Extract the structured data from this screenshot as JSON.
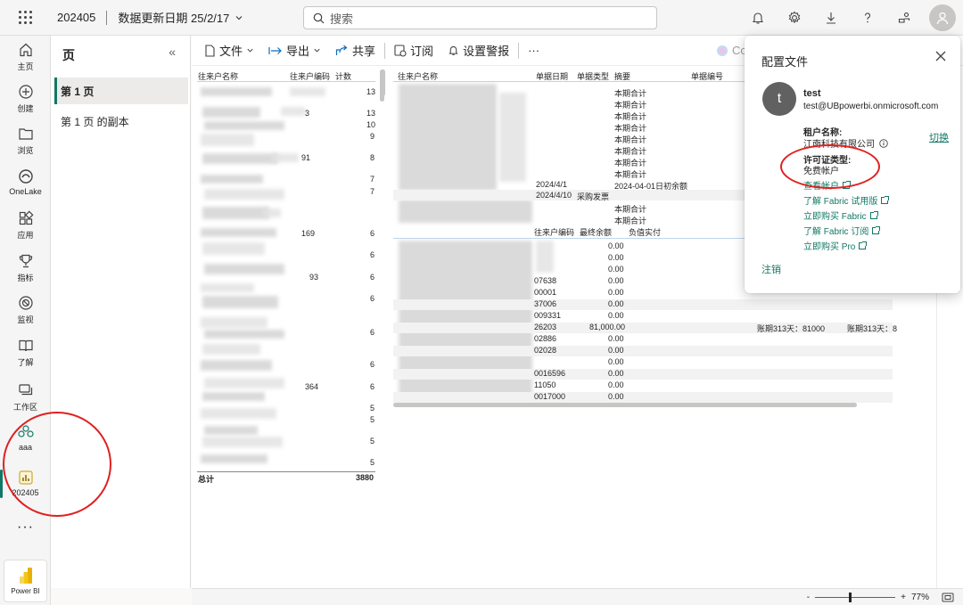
{
  "topbar": {
    "workspace": "202405",
    "refresh_label": "数据更新日期 25/2/17",
    "search_placeholder": "搜索"
  },
  "rail": [
    {
      "label": "主页",
      "icon": "home-icon"
    },
    {
      "label": "创建",
      "icon": "create-icon"
    },
    {
      "label": "浏览",
      "icon": "browse-icon"
    },
    {
      "label": "OneLake",
      "icon": "onelake-icon"
    },
    {
      "label": "应用",
      "icon": "apps-icon"
    },
    {
      "label": "指标",
      "icon": "metrics-icon"
    },
    {
      "label": "监视",
      "icon": "monitor-icon"
    },
    {
      "label": "了解",
      "icon": "learn-icon"
    },
    {
      "label": "工作区",
      "icon": "workspaces-icon"
    },
    {
      "label": "aaa",
      "icon": "workspace-aaa-icon"
    },
    {
      "label": "202405",
      "icon": "report-icon"
    }
  ],
  "rail_more": "···",
  "powerbi_label": "Power BI",
  "pages_pane": {
    "title": "页",
    "collapse": "«",
    "items": [
      "第 1 页",
      "第 1 页 的副本"
    ]
  },
  "toolbar": {
    "file": "文件",
    "export": "导出",
    "share": "共享",
    "subscribe": "订阅",
    "alert": "设置警报",
    "more": "···",
    "copilot": "Co"
  },
  "table1": {
    "headers": [
      "往来户名称",
      "往来户编码",
      "计数"
    ],
    "counts": [
      "13",
      "13",
      "10",
      "9",
      "8",
      "7",
      "7",
      "6",
      "6",
      "6",
      "6",
      "6",
      "6",
      "6",
      "5",
      "5",
      "5",
      "5",
      "5"
    ],
    "partial_codes": [
      "3",
      "91",
      "169",
      "93",
      "364"
    ],
    "total_label": "总计",
    "total_value": "3880"
  },
  "table2": {
    "headers": [
      "往来户名称",
      "单据日期",
      "单据类型",
      "摘要",
      "单据编号"
    ],
    "summaries": [
      "本期合计",
      "本期合计",
      "本期合计",
      "本期合计",
      "本期合计",
      "本期合计",
      "本期合计",
      "本期合计"
    ],
    "row_a": {
      "date": "2024/4/1",
      "summary": "2024-04-01日初余额"
    },
    "row_b": {
      "date": "2024/4/10",
      "type": "采购发票"
    },
    "summaries_after": [
      "本期合计",
      "本期合计"
    ]
  },
  "table3": {
    "headers": [
      "往来户编码",
      "最终余额",
      "负值实付"
    ],
    "codes": [
      "",
      "",
      "",
      "07638",
      "00001",
      "37006",
      "009331",
      "26203",
      "02886",
      "02028",
      "",
      "0016596",
      "11050",
      "0017000"
    ],
    "balances": [
      "0.00",
      "0.00",
      "0.00",
      "0.00",
      "0.00",
      "0.00",
      "0.00",
      "81,000.00",
      "0.00",
      "0.00",
      "0.00",
      "0.00",
      "0.00",
      "0.00"
    ],
    "aging_a": "账期313天：81000",
    "aging_b": "账期313天：8"
  },
  "zoom": {
    "minus": "-",
    "plus": "+",
    "value": "77%"
  },
  "profile": {
    "title": "配置文件",
    "avatar_letter": "t",
    "name": "test",
    "email": "test@UBpowerbi.onmicrosoft.com",
    "tenant_label": "租户名称:",
    "tenant_value": "江南科技有限公司",
    "switch": "切换",
    "license_label": "许可证类型:",
    "license_value": "免费帐户",
    "links": [
      "查看帐户",
      "了解 Fabric 试用版",
      "立即购买 Fabric",
      "了解 Fabric 订阅",
      "立即购买 Pro"
    ],
    "signout": "注销"
  }
}
